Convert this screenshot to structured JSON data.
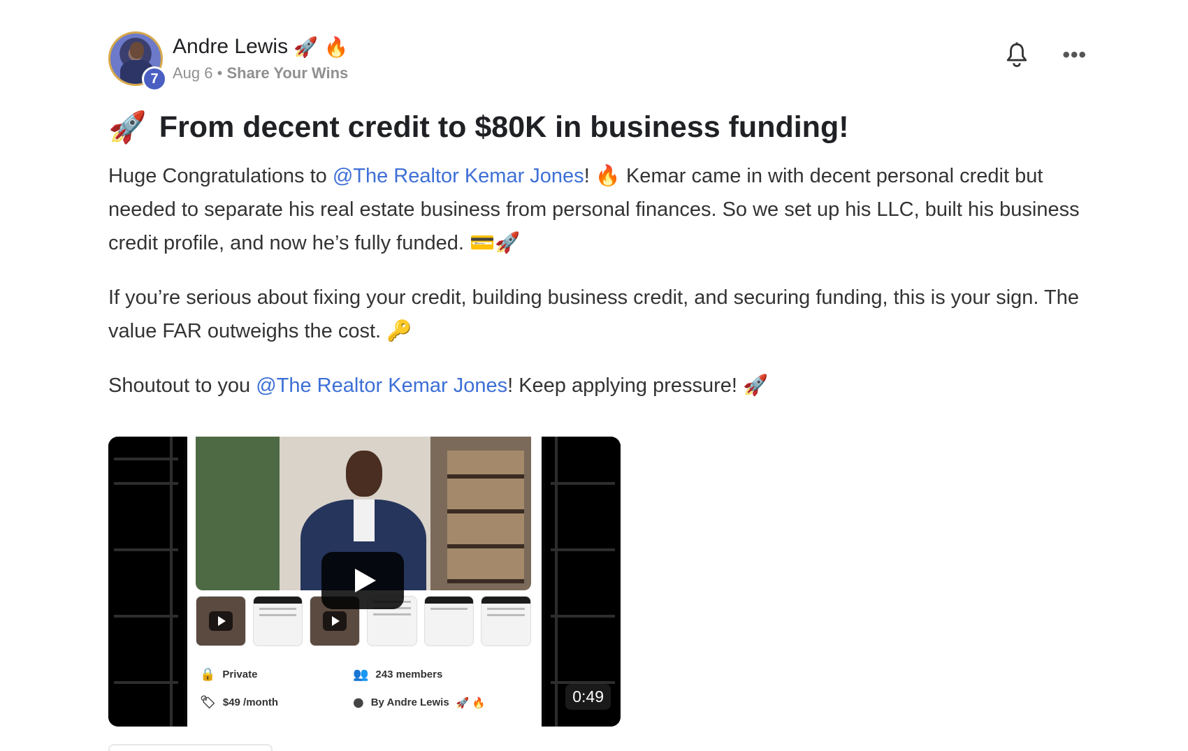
{
  "author": {
    "name": "Andre Lewis",
    "name_emojis": "🚀 🔥",
    "level": "7",
    "date": "Aug 6",
    "separator": "•",
    "category": "Share Your Wins"
  },
  "actions": {
    "bell_icon": "bell-icon",
    "more_label": "•••"
  },
  "post": {
    "title_emoji": "🚀",
    "title": "From decent credit to $80K in business funding!",
    "p1_a": "Huge Congratulations to ",
    "p1_mention": "@The Realtor Kemar Jones",
    "p1_b": "! 🔥 Kemar came in with decent personal credit but needed to separate his real estate business from personal finances. So we set up his LLC, built his business credit profile, and now he’s fully funded. 💳🚀",
    "p2": "If you’re serious about fixing your credit, building business credit, and securing funding, this is your sign. The value FAR outweighs the cost. 🔑",
    "p3_a": "Shoutout to you ",
    "p3_mention": "@The Realtor Kemar Jones",
    "p3_b": "! Keep applying pressure! 🚀"
  },
  "video": {
    "duration": "0:49",
    "info": {
      "privacy": "Private",
      "members": "243 members",
      "price": "$49 /month",
      "by": "By Andre Lewis",
      "by_emojis": "🚀 🔥"
    }
  }
}
